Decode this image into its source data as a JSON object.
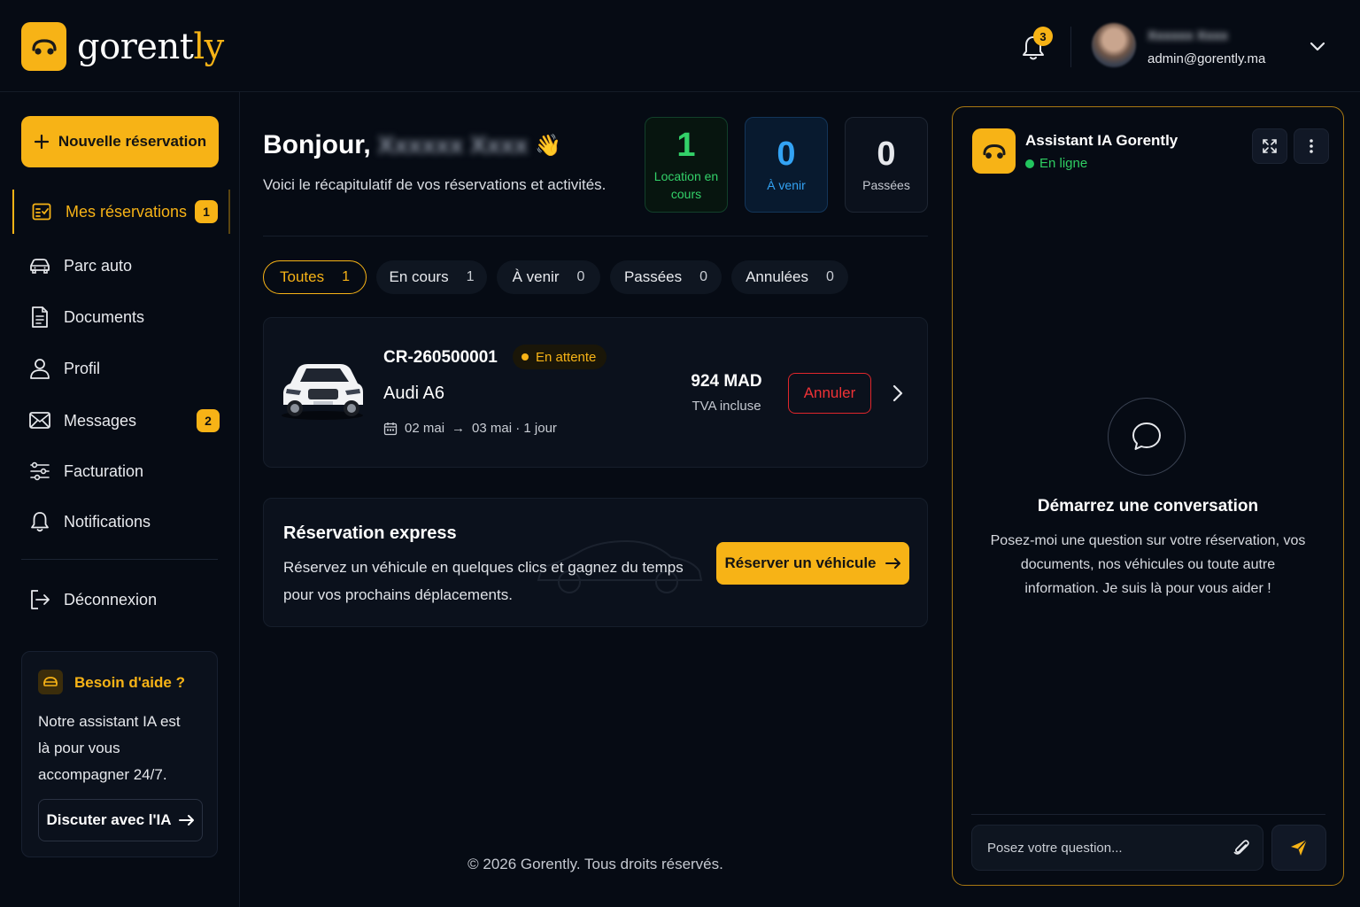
{
  "app": {
    "brand_main": "gorent",
    "brand_accent": "ly",
    "accent_color": "#f7b316"
  },
  "header": {
    "notification_count": "3",
    "user_name": "Xxxxxx Xxxx",
    "user_email": "admin@gorently.ma"
  },
  "sidebar": {
    "new_reservation_label": "Nouvelle réservation",
    "items": [
      {
        "label": "Mes réservations",
        "icon": "calendar-icon",
        "badge": "1",
        "active": true
      },
      {
        "label": "Parc auto",
        "icon": "car-icon"
      },
      {
        "label": "Documents",
        "icon": "document-icon"
      },
      {
        "label": "Profil",
        "icon": "user-icon"
      },
      {
        "label": "Messages",
        "icon": "mail-icon",
        "badge": "2"
      },
      {
        "label": "Facturation",
        "icon": "sliders-icon"
      },
      {
        "label": "Notifications",
        "icon": "bell-icon"
      }
    ],
    "logout_label": "Déconnexion",
    "help": {
      "title": "Besoin d'aide ?",
      "text": "Notre assistant IA est là pour vous accompagner 24/7.",
      "button": "Discuter avec l'IA"
    }
  },
  "main": {
    "greeting": "Bonjour,",
    "greeting_name": "Xxxxxx Xxxx",
    "greeting_emoji": "👋",
    "subtitle": "Voici le récapitulatif de vos réservations et activités.",
    "stats": {
      "current": {
        "value": "1",
        "label": "Location en cours"
      },
      "upcoming": {
        "value": "0",
        "label": "À venir"
      },
      "past": {
        "value": "0",
        "label": "Passées"
      }
    },
    "tabs": [
      {
        "label": "Toutes",
        "count": "1",
        "active": true
      },
      {
        "label": "En cours",
        "count": "1"
      },
      {
        "label": "À venir",
        "count": "0"
      },
      {
        "label": "Passées",
        "count": "0"
      },
      {
        "label": "Annulées",
        "count": "0"
      }
    ],
    "reservation": {
      "code": "CR-260500001",
      "status": "En attente",
      "model": "Audi A6",
      "date_from": "02 mai",
      "arrow": "→",
      "date_to": "03 mai · 1 jour",
      "price": "924 MAD",
      "vat": "TVA incluse",
      "cancel_label": "Annuler"
    },
    "express": {
      "title": "Réservation express",
      "text": "Réservez un véhicule en quelques clics et gagnez du temps pour vos prochains déplacements.",
      "button": "Réserver un véhicule"
    },
    "footer": "© 2026 Gorently. Tous droits réservés."
  },
  "assistant": {
    "title": "Assistant IA Gorently",
    "status": "En ligne",
    "empty_title": "Démarrez une conversation",
    "empty_text": "Posez-moi une question sur votre réservation, vos documents, nos véhicules ou toute autre information. Je suis là pour vous aider !",
    "input_placeholder": "Posez votre question..."
  }
}
